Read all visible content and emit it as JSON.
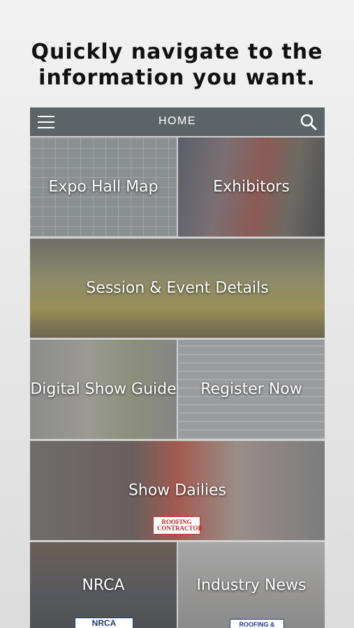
{
  "headline": {
    "line1": "Quickly navigate to the",
    "line2": "information you want."
  },
  "navbar": {
    "title": "HOME",
    "menu_icon": "hamburger-menu-icon",
    "search_icon": "search-icon",
    "background_color": "#5b6568"
  },
  "tiles": [
    {
      "label": "Expo Hall Map"
    },
    {
      "label": "Exhibitors"
    },
    {
      "label": "Session & Event Details"
    },
    {
      "label": "Digital Show Guide"
    },
    {
      "label": "Register Now"
    },
    {
      "label": "Show Dailies"
    },
    {
      "label": "NRCA"
    },
    {
      "label": "Industry News"
    }
  ],
  "badges": {
    "roofing_contractor": "ROOFING CONTRACTOR",
    "nrca": "NRCA",
    "roofing_news": "ROOFING &"
  }
}
